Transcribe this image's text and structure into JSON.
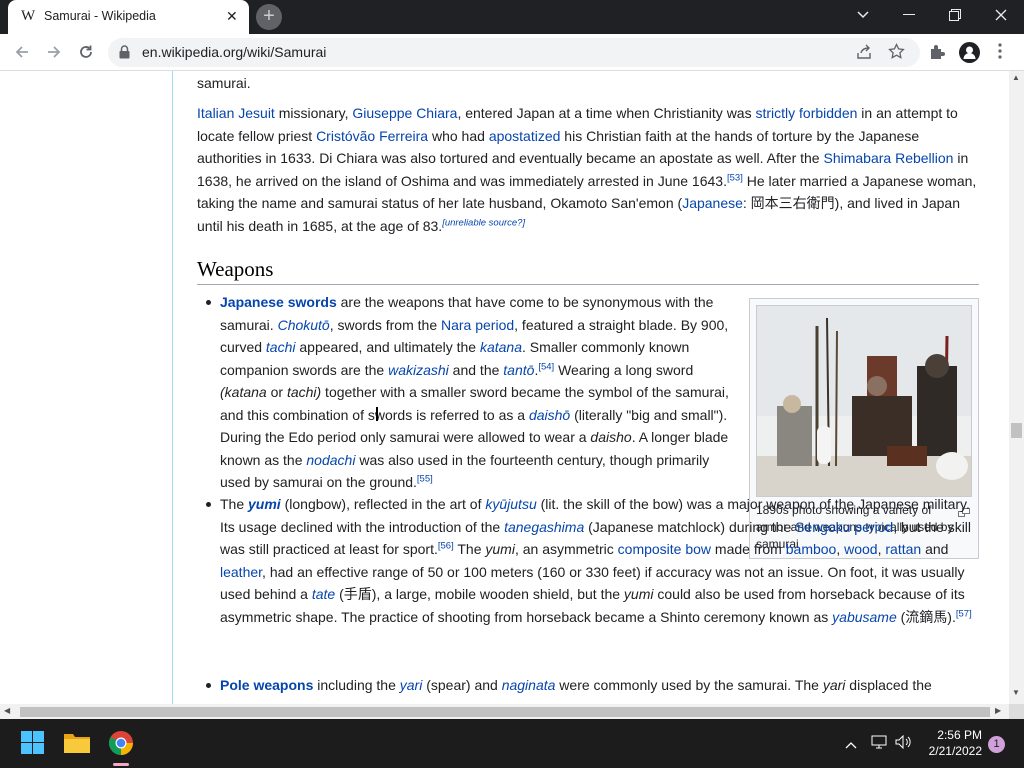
{
  "browser": {
    "tab_title": "Samurai - Wikipedia",
    "tab_icon": "W",
    "url": "en.wikipedia.org/wiki/Samurai"
  },
  "article": {
    "p0": "samurai.",
    "p1": {
      "t1": "Italian",
      "t2": " ",
      "t3": "Jesuit",
      "t4": " missionary, ",
      "t5": "Giuseppe Chiara",
      "t6": ", entered Japan at a time when Christianity was ",
      "t7": "strictly forbidden",
      "t8": " in an attempt to locate fellow priest ",
      "t9": "Cristóvão Ferreira",
      "t10": " who had ",
      "t11": "apostatized",
      "t12": " his Christian faith at the hands of torture by the Japanese authorities in 1633. Di Chiara was also tortured and eventually became an apostate as well. After the ",
      "t13": "Shimabara Rebellion",
      "t14": " in 1638, he arrived on the island of Oshima and was immediately arrested in June 1643.",
      "t15": "[53]",
      "t16": " He later married a Japanese woman, taking the name and samurai status of her late husband, Okamoto San'emon (",
      "t17": "Japanese",
      "t18": ": 岡本三右衛門), and lived in Japan until his death in 1685, at the age of 83.",
      "t19": "[unreliable source?]"
    },
    "heading": "Weapons",
    "li1": {
      "t1": "Japanese swords",
      "t2": " are the weapons that have come to be synonymous with the samurai. ",
      "t3": "Chokutō",
      "t4": ", swords from the ",
      "t5": "Nara period",
      "t6": ", featured a straight blade. By 900, curved ",
      "t7": "tachi",
      "t8": " appeared, and ultimately the ",
      "t9": "katana",
      "t10": ". Smaller commonly known companion swords are the ",
      "t11": "wakizashi",
      "t12": " and the ",
      "t13": "tantō",
      "t14": ".",
      "t15": "[54]",
      "t16": " Wearing a long sword ",
      "t17": "(katana",
      "t18": " or ",
      "t19": "tachi)",
      "t20": " together with a smaller sword became the symbol of the samurai, and this combination of swords is referred to as a ",
      "t21": "daishō",
      "t22": " (literally \"big and small\"). During the Edo period only samurai were allowed to wear a ",
      "t23": "daisho",
      "t24": ". A longer blade known as the ",
      "t25": "nodachi",
      "t26": " was also used in the fourteenth century, though primarily used by samurai on the ground.",
      "t27": "[55]"
    },
    "li2": {
      "t1": "The ",
      "t2": "yumi",
      "t3": " (longbow), reflected in the art of ",
      "t4": "kyūjutsu",
      "t5": " (lit. the skill of the bow) was a major weapon of the Japanese military. Its usage declined with the introduction of the ",
      "t6": "tanegashima",
      "t7": " (Japanese matchlock) during the ",
      "t8": "Sengoku period",
      "t9": ", but the skill was still practiced at least for sport.",
      "t10": "[56]",
      "t11": " The ",
      "t12": "yumi",
      "t13": ", an asymmetric ",
      "t14": "composite bow",
      "t15": " made from ",
      "t16": "bamboo",
      "t17": ", ",
      "t18": "wood",
      "t19": ", ",
      "t20": "rattan",
      "t21": " and ",
      "t22": "leather",
      "t23": ", had an effective range of 50 or 100 meters (160 or 330 feet) if accuracy was not an issue. On foot, it was usually used behind a ",
      "t24": "tate",
      "t25": " (手盾), a large, mobile wooden shield, but the ",
      "t26": "yumi",
      "t27": " could also be used from horseback because of its asymmetric shape. The practice of shooting from horseback became a Shinto ceremony known as ",
      "t28": "yabusame",
      "t29": " (流鏑馬).",
      "t30": "[57]"
    },
    "li3": {
      "t1": "Pole weapons",
      "t2": " including the ",
      "t3": "yari",
      "t4": " (spear) and ",
      "t5": "naginata",
      "t6": " were commonly used by the samurai. The ",
      "t7": "yari",
      "t8": " displaced the"
    },
    "figure_caption": "1890s photo showing a variety of armor and weapons typically used by samurai"
  },
  "taskbar": {
    "time": "2:56 PM",
    "date": "2/21/2022",
    "notification_count": "1"
  },
  "colors": {
    "link": "#0645ad",
    "titlebar": "#202124",
    "taskbar": "#1c1c1c"
  }
}
